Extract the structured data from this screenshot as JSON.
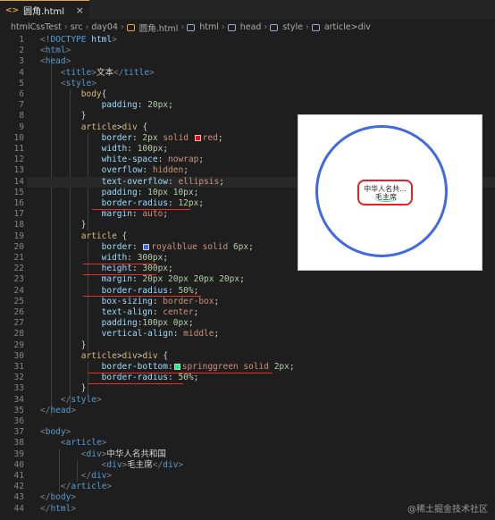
{
  "tab": {
    "lang": "<>",
    "title": "圆角.html",
    "close": "×"
  },
  "breadcrumb": [
    "htmlCssTest",
    "src",
    "day04",
    "圆角.html",
    "html",
    "head",
    "style",
    "article>div"
  ],
  "lines": [
    {
      "n": "1",
      "segs": [
        [
          "punc",
          "<!"
        ],
        [
          "tag",
          "DOCTYPE"
        ],
        [
          "txt",
          " "
        ],
        [
          "prop",
          "html"
        ],
        [
          "punc",
          ">"
        ]
      ]
    },
    {
      "n": "2",
      "segs": [
        [
          "punc",
          "<"
        ],
        [
          "tag",
          "html"
        ],
        [
          "punc",
          ">"
        ]
      ]
    },
    {
      "n": "3",
      "segs": [
        [
          "punc",
          "<"
        ],
        [
          "tag",
          "head"
        ],
        [
          "punc",
          ">"
        ]
      ]
    },
    {
      "n": "4",
      "segs": [
        [
          "txt",
          "    "
        ],
        [
          "punc",
          "<"
        ],
        [
          "tag",
          "title"
        ],
        [
          "punc",
          ">"
        ],
        [
          "txt",
          "文本"
        ],
        [
          "punc",
          "</"
        ],
        [
          "tag",
          "title"
        ],
        [
          "punc",
          ">"
        ]
      ]
    },
    {
      "n": "5",
      "segs": [
        [
          "txt",
          "    "
        ],
        [
          "punc",
          "<"
        ],
        [
          "tag",
          "style"
        ],
        [
          "punc",
          ">"
        ]
      ]
    },
    {
      "n": "6",
      "segs": [
        [
          "txt",
          "        "
        ],
        [
          "sel",
          "body"
        ],
        [
          "txt",
          "{"
        ]
      ]
    },
    {
      "n": "7",
      "segs": [
        [
          "txt",
          "            "
        ],
        [
          "prop",
          "padding"
        ],
        [
          "txt",
          ": "
        ],
        [
          "num",
          "20px"
        ],
        [
          "txt",
          ";"
        ]
      ]
    },
    {
      "n": "8",
      "segs": [
        [
          "txt",
          "        }"
        ]
      ]
    },
    {
      "n": "9",
      "segs": [
        [
          "txt",
          "        "
        ],
        [
          "sel",
          "article"
        ],
        [
          "txt",
          ">"
        ],
        [
          "sel",
          "div"
        ],
        [
          "txt",
          " {"
        ]
      ]
    },
    {
      "n": "10",
      "segs": [
        [
          "txt",
          "            "
        ],
        [
          "prop",
          "border"
        ],
        [
          "txt",
          ": "
        ],
        [
          "num",
          "2px"
        ],
        [
          "val",
          " solid "
        ],
        [
          "swatch",
          "red"
        ],
        [
          "val",
          "red"
        ],
        [
          "txt",
          ";"
        ]
      ]
    },
    {
      "n": "11",
      "segs": [
        [
          "txt",
          "            "
        ],
        [
          "prop",
          "width"
        ],
        [
          "txt",
          ": "
        ],
        [
          "num",
          "100px"
        ],
        [
          "txt",
          ";"
        ]
      ]
    },
    {
      "n": "12",
      "segs": [
        [
          "txt",
          "            "
        ],
        [
          "prop",
          "white-space"
        ],
        [
          "txt",
          ": "
        ],
        [
          "val",
          "nowrap"
        ],
        [
          "txt",
          ";"
        ]
      ]
    },
    {
      "n": "13",
      "segs": [
        [
          "txt",
          "            "
        ],
        [
          "prop",
          "overflow"
        ],
        [
          "txt",
          ": "
        ],
        [
          "val",
          "hidden"
        ],
        [
          "txt",
          ";"
        ]
      ]
    },
    {
      "n": "14",
      "segs": [
        [
          "txt",
          "            "
        ],
        [
          "prop",
          "text-overflow"
        ],
        [
          "txt",
          ": "
        ],
        [
          "val",
          "ellipsis"
        ],
        [
          "txt",
          ";"
        ]
      ]
    },
    {
      "n": "15",
      "segs": [
        [
          "txt",
          "            "
        ],
        [
          "prop",
          "padding"
        ],
        [
          "txt",
          ": "
        ],
        [
          "num",
          "10px 10px"
        ],
        [
          "txt",
          ";"
        ]
      ]
    },
    {
      "n": "16",
      "segs": [
        [
          "txt",
          "            "
        ],
        [
          "prop",
          "border-radius"
        ],
        [
          "txt",
          ": "
        ],
        [
          "num",
          "12px"
        ],
        [
          "txt",
          ";"
        ]
      ]
    },
    {
      "n": "17",
      "segs": [
        [
          "txt",
          "            "
        ],
        [
          "prop",
          "margin"
        ],
        [
          "txt",
          ": "
        ],
        [
          "val",
          "auto"
        ],
        [
          "txt",
          ";"
        ]
      ]
    },
    {
      "n": "18",
      "segs": [
        [
          "txt",
          "        }"
        ]
      ]
    },
    {
      "n": "19",
      "segs": [
        [
          "txt",
          "        "
        ],
        [
          "sel",
          "article"
        ],
        [
          "txt",
          " {"
        ]
      ]
    },
    {
      "n": "20",
      "segs": [
        [
          "txt",
          "            "
        ],
        [
          "prop",
          "border"
        ],
        [
          "txt",
          ": "
        ],
        [
          "swatch",
          "royalblue"
        ],
        [
          "val",
          "royalblue solid "
        ],
        [
          "num",
          "6px"
        ],
        [
          "txt",
          ";"
        ]
      ]
    },
    {
      "n": "21",
      "segs": [
        [
          "txt",
          "            "
        ],
        [
          "prop",
          "width"
        ],
        [
          "txt",
          ": "
        ],
        [
          "num",
          "300px"
        ],
        [
          "txt",
          ";"
        ]
      ]
    },
    {
      "n": "22",
      "segs": [
        [
          "txt",
          "            "
        ],
        [
          "prop",
          "height"
        ],
        [
          "txt",
          ": "
        ],
        [
          "num",
          "300px"
        ],
        [
          "txt",
          ";"
        ]
      ]
    },
    {
      "n": "23",
      "segs": [
        [
          "txt",
          "            "
        ],
        [
          "prop",
          "margin"
        ],
        [
          "txt",
          ": "
        ],
        [
          "num",
          "20px 20px 20px 20px"
        ],
        [
          "txt",
          ";"
        ]
      ]
    },
    {
      "n": "24",
      "segs": [
        [
          "txt",
          "            "
        ],
        [
          "prop",
          "border-radius"
        ],
        [
          "txt",
          ": "
        ],
        [
          "num",
          "50%"
        ],
        [
          "txt",
          ";"
        ]
      ]
    },
    {
      "n": "25",
      "segs": [
        [
          "txt",
          "            "
        ],
        [
          "prop",
          "box-sizing"
        ],
        [
          "txt",
          ": "
        ],
        [
          "val",
          "border-box"
        ],
        [
          "txt",
          ";"
        ]
      ]
    },
    {
      "n": "26",
      "segs": [
        [
          "txt",
          "            "
        ],
        [
          "prop",
          "text-align"
        ],
        [
          "txt",
          ": "
        ],
        [
          "val",
          "center"
        ],
        [
          "txt",
          ";"
        ]
      ]
    },
    {
      "n": "27",
      "segs": [
        [
          "txt",
          "            "
        ],
        [
          "prop",
          "padding"
        ],
        [
          "txt",
          ":"
        ],
        [
          "num",
          "100px 0px"
        ],
        [
          "txt",
          ";"
        ]
      ]
    },
    {
      "n": "28",
      "segs": [
        [
          "txt",
          "            "
        ],
        [
          "prop",
          "vertical-align"
        ],
        [
          "txt",
          ": "
        ],
        [
          "val",
          "middle"
        ],
        [
          "txt",
          ";"
        ]
      ]
    },
    {
      "n": "29",
      "segs": [
        [
          "txt",
          "        }"
        ]
      ]
    },
    {
      "n": "30",
      "segs": [
        [
          "txt",
          "        "
        ],
        [
          "sel",
          "article"
        ],
        [
          "txt",
          ">"
        ],
        [
          "sel",
          "div"
        ],
        [
          "txt",
          ">"
        ],
        [
          "sel",
          "div"
        ],
        [
          "txt",
          " {"
        ]
      ]
    },
    {
      "n": "31",
      "segs": [
        [
          "txt",
          "            "
        ],
        [
          "prop",
          "border-bottom"
        ],
        [
          "txt",
          ":"
        ],
        [
          "swatch",
          "springgreen"
        ],
        [
          "val",
          "springgreen solid "
        ],
        [
          "num",
          "2px"
        ],
        [
          "txt",
          ";"
        ]
      ]
    },
    {
      "n": "32",
      "segs": [
        [
          "txt",
          "            "
        ],
        [
          "prop",
          "border-radius"
        ],
        [
          "txt",
          ": "
        ],
        [
          "num",
          "50%"
        ],
        [
          "txt",
          ";"
        ]
      ]
    },
    {
      "n": "33",
      "segs": [
        [
          "txt",
          "        }"
        ]
      ]
    },
    {
      "n": "34",
      "segs": [
        [
          "txt",
          "    "
        ],
        [
          "punc",
          "</"
        ],
        [
          "tag",
          "style"
        ],
        [
          "punc",
          ">"
        ]
      ]
    },
    {
      "n": "35",
      "segs": [
        [
          "punc",
          "</"
        ],
        [
          "tag",
          "head"
        ],
        [
          "punc",
          ">"
        ]
      ]
    },
    {
      "n": "36",
      "segs": []
    },
    {
      "n": "37",
      "segs": [
        [
          "punc",
          "<"
        ],
        [
          "tag",
          "body"
        ],
        [
          "punc",
          ">"
        ]
      ]
    },
    {
      "n": "38",
      "segs": [
        [
          "txt",
          "    "
        ],
        [
          "punc",
          "<"
        ],
        [
          "tag",
          "article"
        ],
        [
          "punc",
          ">"
        ]
      ]
    },
    {
      "n": "39",
      "segs": [
        [
          "txt",
          "        "
        ],
        [
          "punc",
          "<"
        ],
        [
          "tag",
          "div"
        ],
        [
          "punc",
          ">"
        ],
        [
          "txt",
          "中华人名共和国"
        ]
      ]
    },
    {
      "n": "40",
      "segs": [
        [
          "txt",
          "            "
        ],
        [
          "punc",
          "<"
        ],
        [
          "tag",
          "div"
        ],
        [
          "punc",
          ">"
        ],
        [
          "txt",
          "毛主席"
        ],
        [
          "punc",
          "</"
        ],
        [
          "tag",
          "div"
        ],
        [
          "punc",
          ">"
        ]
      ]
    },
    {
      "n": "41",
      "segs": [
        [
          "txt",
          "        "
        ],
        [
          "punc",
          "</"
        ],
        [
          "tag",
          "div"
        ],
        [
          "punc",
          ">"
        ]
      ]
    },
    {
      "n": "42",
      "segs": [
        [
          "txt",
          "    "
        ],
        [
          "punc",
          "</"
        ],
        [
          "tag",
          "article"
        ],
        [
          "punc",
          ">"
        ]
      ]
    },
    {
      "n": "43",
      "segs": [
        [
          "punc",
          "</"
        ],
        [
          "tag",
          "body"
        ],
        [
          "punc",
          ">"
        ]
      ]
    },
    {
      "n": "44",
      "segs": [
        [
          "punc",
          "</"
        ],
        [
          "tag",
          "html"
        ],
        [
          "punc",
          ">"
        ]
      ]
    }
  ],
  "preview": {
    "line1": "中华人名共...",
    "line2": "毛主席"
  },
  "watermark": "@稀土掘金技术社区",
  "colors": {
    "red": "#ff0000",
    "royalblue": "#4169e1",
    "springgreen": "#00ff7f",
    "annotation": "#e5332a"
  }
}
